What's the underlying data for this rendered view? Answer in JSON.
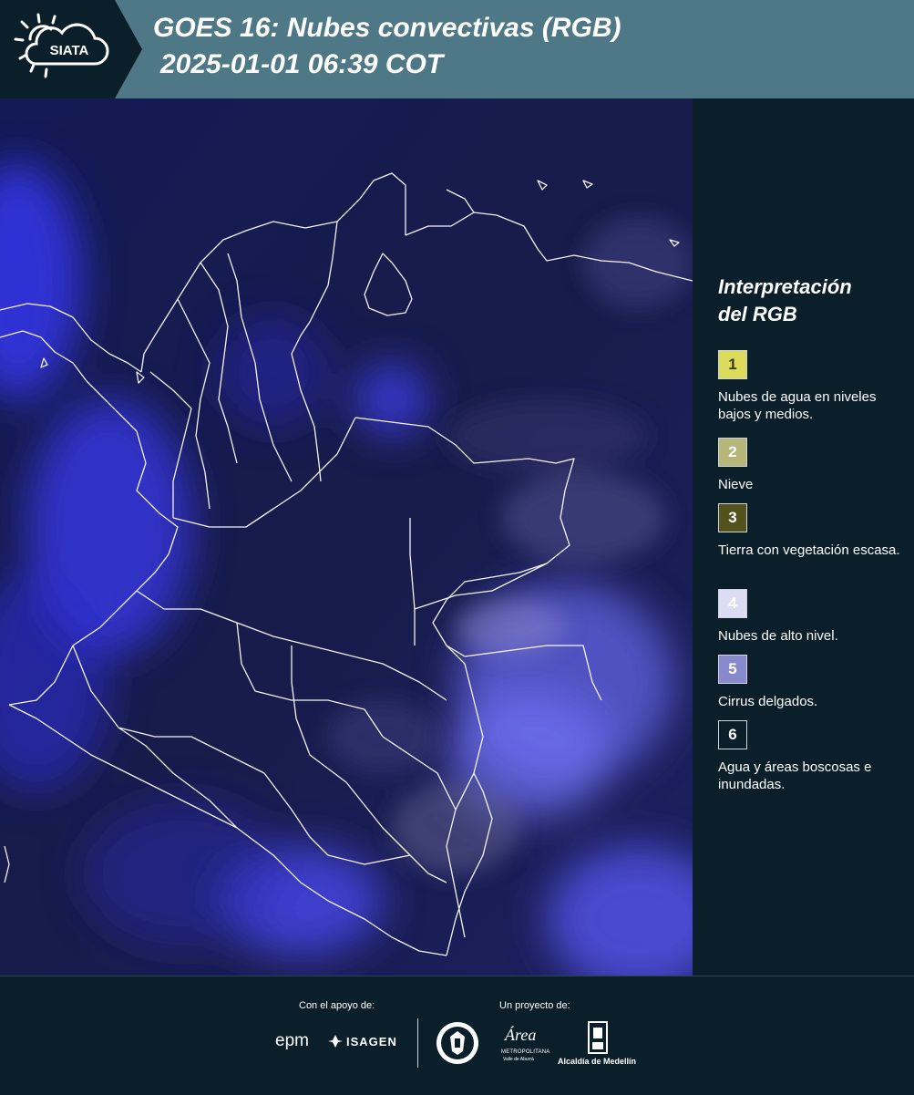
{
  "header": {
    "brand": "SIATA",
    "title_line1": "GOES 16: Nubes convectivas (RGB)",
    "title_line2": "2025-01-01 06:39 COT"
  },
  "legend": {
    "title": "Interpretación del RGB",
    "items": [
      {
        "number": "1",
        "text": "Nubes de agua en niveles bajos y medios.",
        "color": "#dcdc5a",
        "number_color": "#3a3a10"
      },
      {
        "number": "2",
        "text": "Nieve",
        "color": "#b6b678",
        "number_color": "#ffffff"
      },
      {
        "number": "3",
        "text": "Tierra con vegetación escasa.",
        "color": "#54521c",
        "number_color": "#ffffff"
      },
      {
        "number": "4",
        "text": "Nubes de alto nivel.",
        "color": "#dcdcf4",
        "number_color": "#ffffff"
      },
      {
        "number": "5",
        "text": "Cirrus delgados.",
        "color": "#8888cc",
        "number_color": "#ffffff"
      },
      {
        "number": "6",
        "text": "Agua y áreas boscosas e inundadas.",
        "color": "#0b1f2b",
        "number_color": "#ffffff"
      }
    ]
  },
  "footer": {
    "support_label": "Con el apoyo de:",
    "project_label": "Un proyecto de:",
    "sponsor1": "epm",
    "sponsor2": "ISAGEN",
    "partner1": "Área",
    "partner1_sub": "METROPOLITANA",
    "partner1_sub2": "Valle de Aburrá",
    "partner2": "Alcaldía de Medellín"
  },
  "colors": {
    "header_bg": "#4f7886",
    "logo_bg": "#0b1f2b",
    "page_bg": "#0b1f2b",
    "map_base": "#0a1130",
    "cloud_blue": "#3a3af0",
    "border_lines": "#ffffff"
  }
}
